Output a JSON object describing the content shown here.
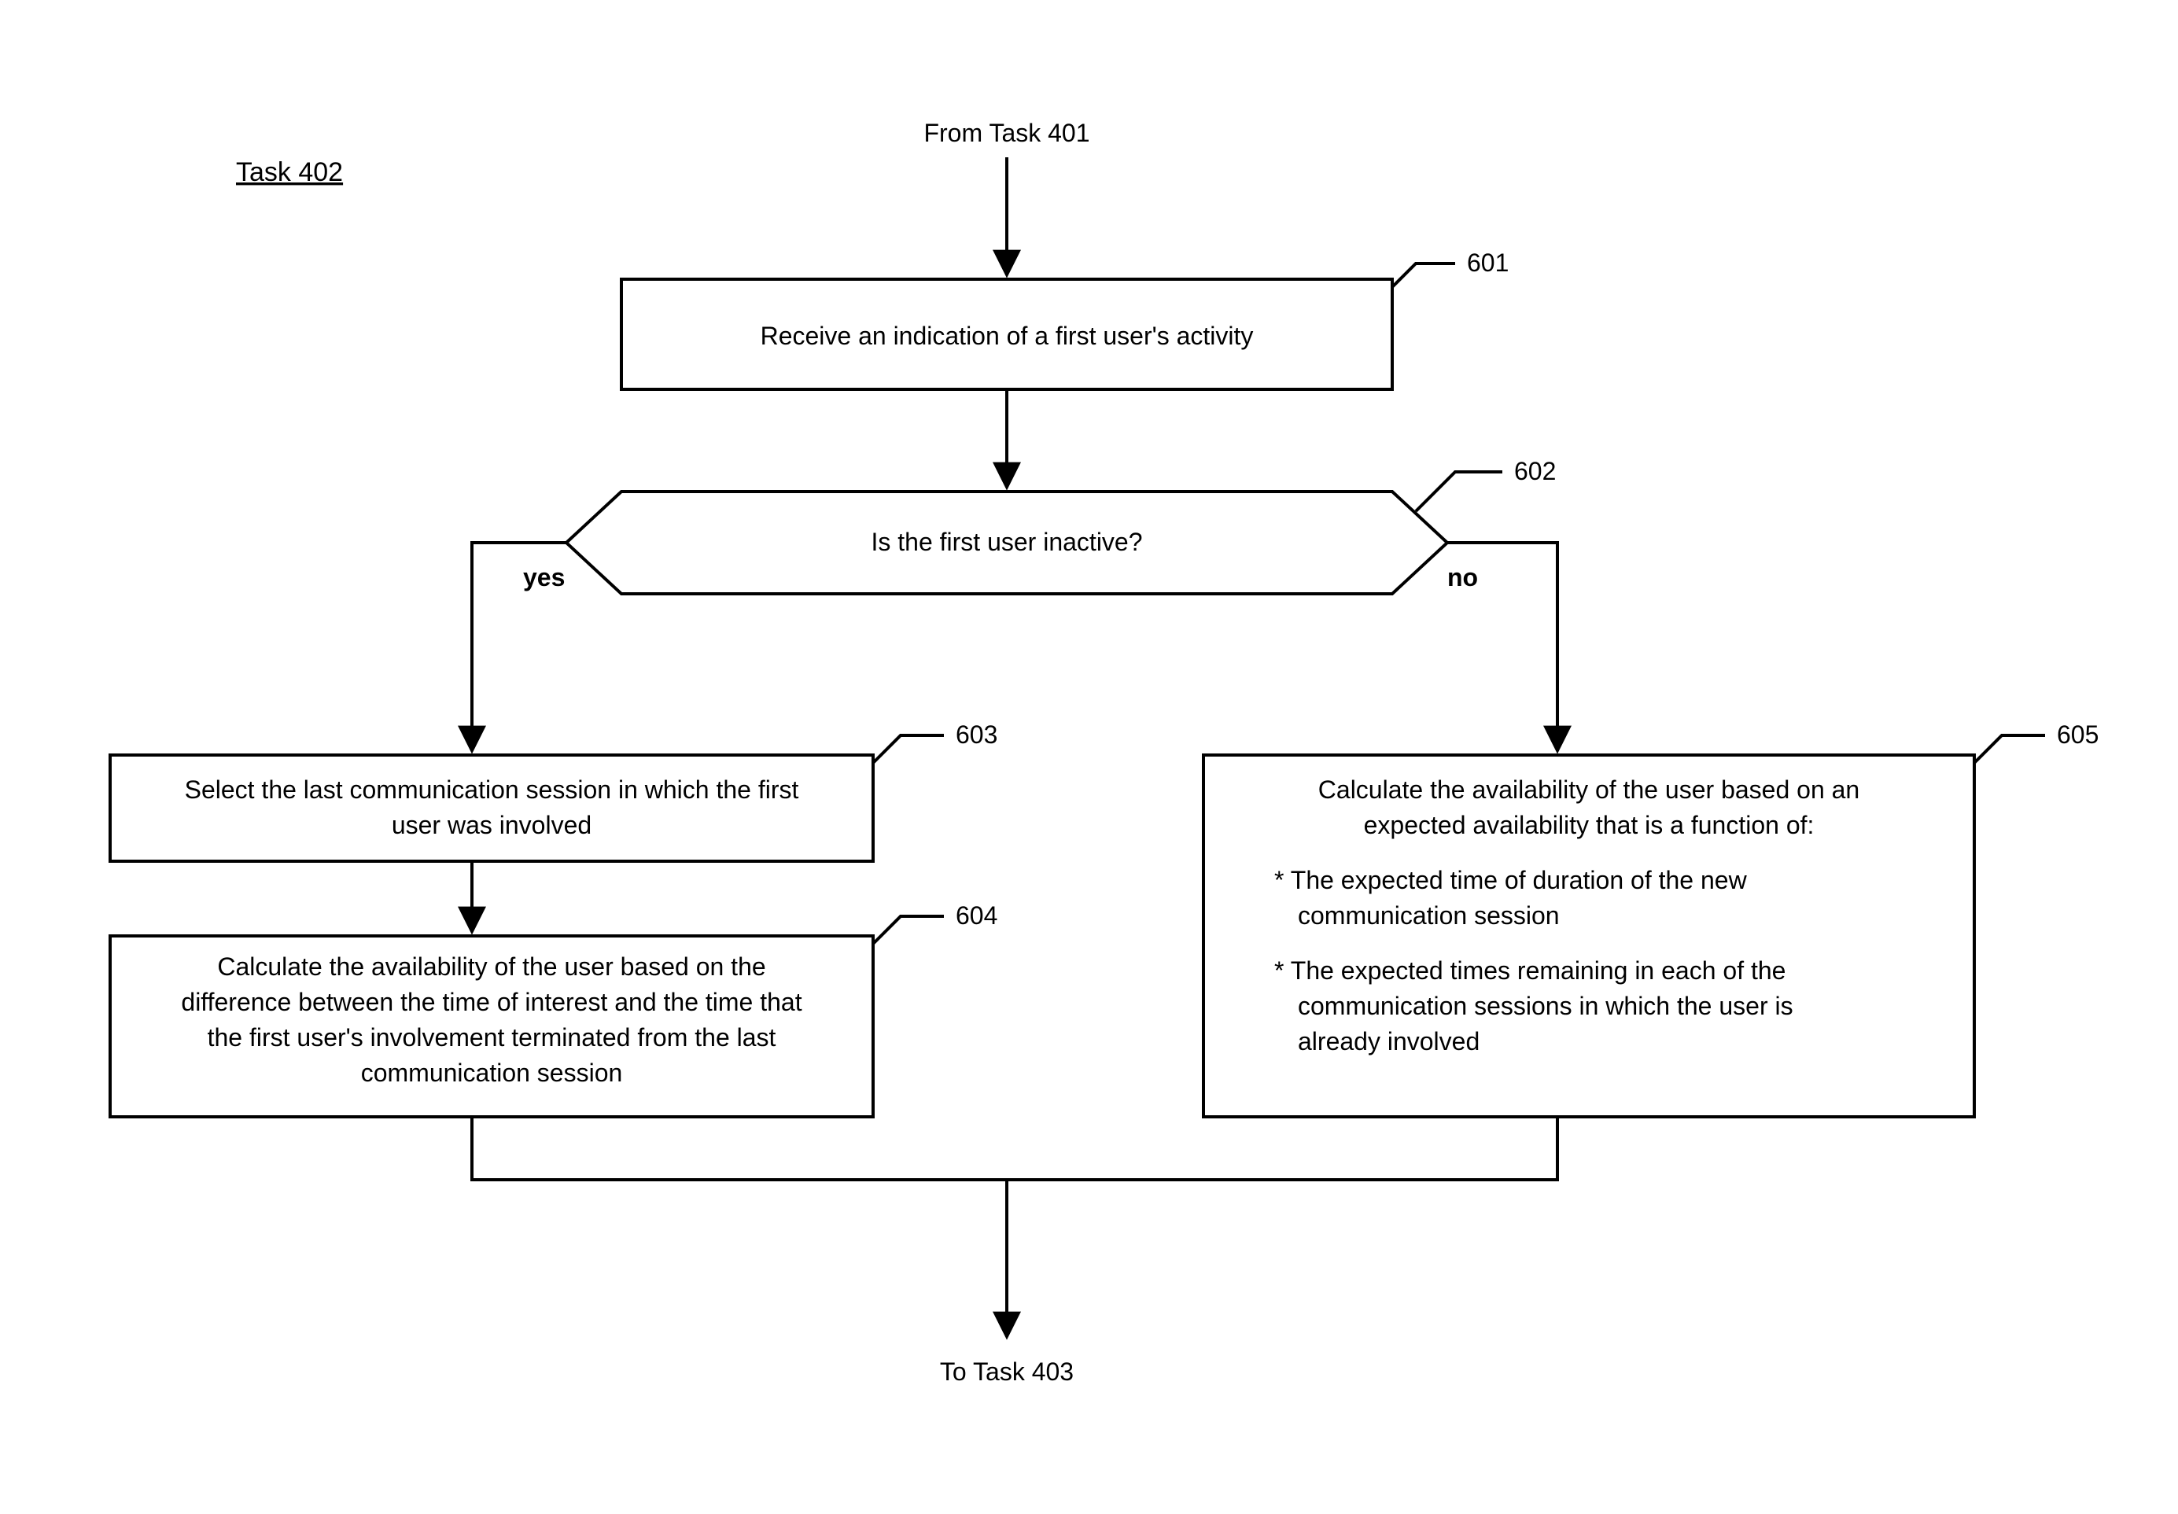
{
  "flow": {
    "task_label": "Task 402",
    "from_label": "From Task 401",
    "to_label": "To Task 403",
    "n601": {
      "num": "601",
      "text": "Receive an indication of a first user's activity"
    },
    "n602": {
      "num": "602",
      "text": "Is the first user inactive?",
      "yes": "yes",
      "no": "no"
    },
    "n603": {
      "num": "603",
      "l1": "Select the last communication session in which the first",
      "l2": "user was involved"
    },
    "n604": {
      "num": "604",
      "l1": "Calculate the availability of the user based on the",
      "l2": "difference between the time of interest and the time that",
      "l3": "the first user's involvement terminated from the  last",
      "l4": "communication session"
    },
    "n605": {
      "num": "605",
      "l1": "Calculate the availability of the user based on an",
      "l2": "expected availability that is a function of:",
      "b1": "* The expected time of duration of the new",
      "b1b": "communication session",
      "b2": "* The expected times remaining in each of the",
      "b2b": "communication sessions in which the user is",
      "b2c": "already involved"
    }
  }
}
